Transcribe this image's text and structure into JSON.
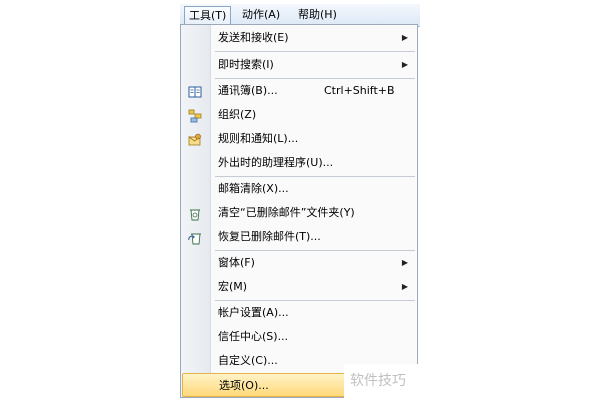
{
  "menubar": {
    "items": [
      {
        "label": "工具(T)"
      },
      {
        "label": "动作(A)"
      },
      {
        "label": "帮助(H)"
      }
    ]
  },
  "menu": {
    "items": [
      {
        "label": "发送和接收(E)",
        "submenu": true
      },
      {
        "label": "即时搜索(I)",
        "submenu": true
      },
      {
        "label": "通讯簿(B)...",
        "shortcut": "Ctrl+Shift+B",
        "icon": "address-book-icon"
      },
      {
        "label": "组织(Z)",
        "icon": "organize-icon"
      },
      {
        "label": "规则和通知(L)...",
        "icon": "rules-icon"
      },
      {
        "label": "外出时的助理程序(U)..."
      },
      {
        "label": "邮箱清除(X)..."
      },
      {
        "label": "清空“已删除邮件”文件夹(Y)",
        "icon": "empty-deleted-icon"
      },
      {
        "label": "恢复已删除邮件(T)...",
        "icon": "recover-deleted-icon"
      },
      {
        "label": "窗体(F)",
        "submenu": true
      },
      {
        "label": "宏(M)",
        "submenu": true
      },
      {
        "label": "帐户设置(A)..."
      },
      {
        "label": "信任中心(S)..."
      },
      {
        "label": "自定义(C)..."
      },
      {
        "label": "选项(O)...",
        "highlighted": true
      }
    ],
    "arrow_glyph": "▶"
  },
  "watermark": {
    "text": "软件技巧"
  },
  "colors": {
    "highlight": "#ffd97a",
    "menubar_bg": "#dce8f6",
    "gutter_bg": "#e6eaef"
  }
}
